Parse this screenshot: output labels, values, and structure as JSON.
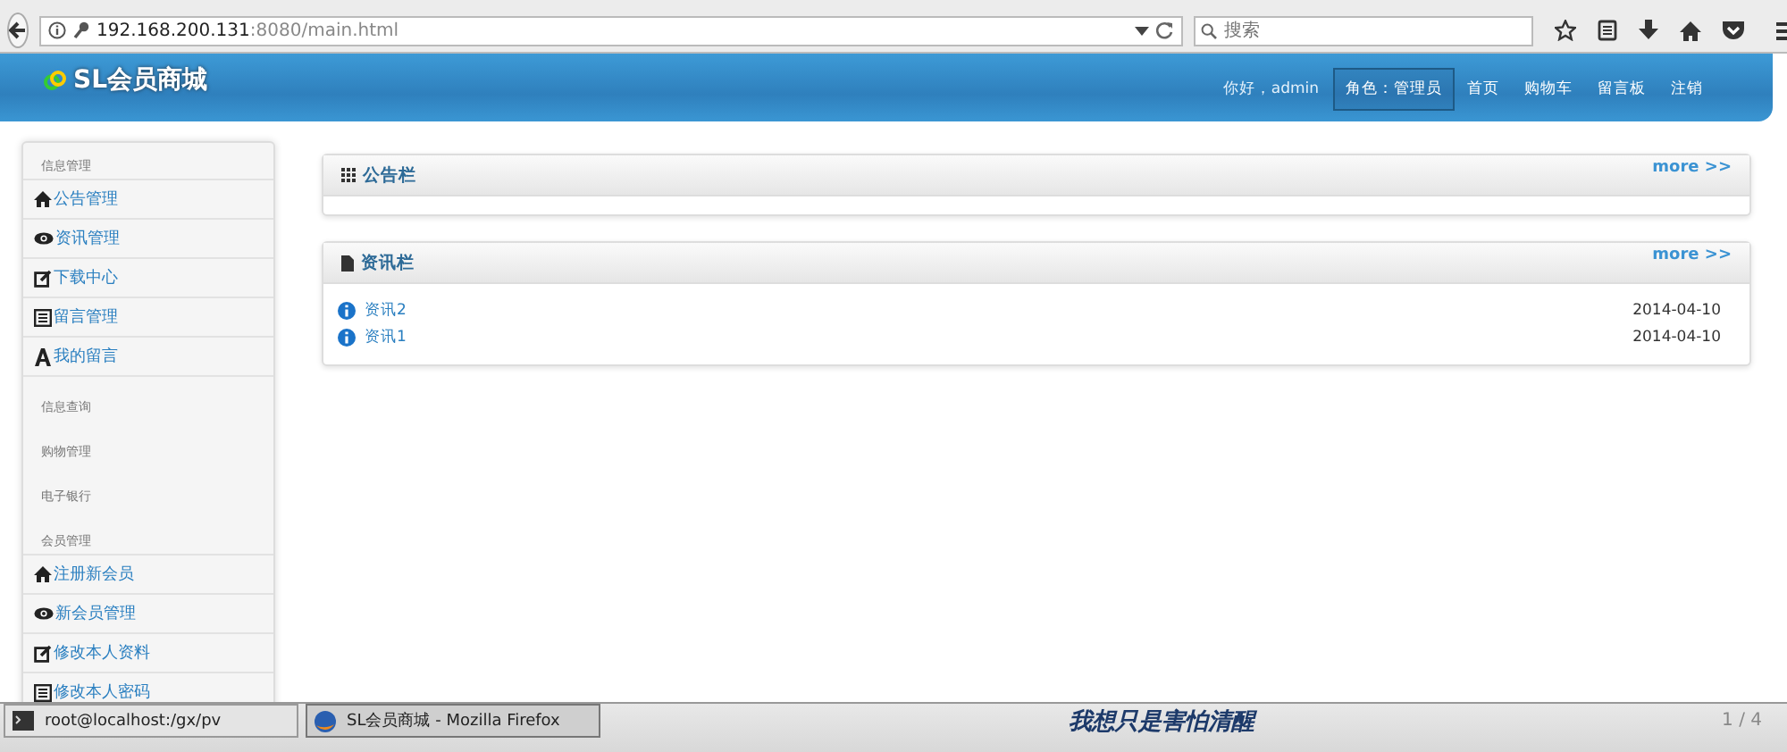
{
  "browser": {
    "url_host": "192.168.200.131",
    "url_rest": ":8080/main.html",
    "search_placeholder": "搜索"
  },
  "header": {
    "logo": "SL会员商城",
    "greeting": "你好，admin",
    "nav": [
      {
        "label": "角色：管理员",
        "selected": true
      },
      {
        "label": "首页",
        "selected": false
      },
      {
        "label": "购物车",
        "selected": false
      },
      {
        "label": "留言板",
        "selected": false
      },
      {
        "label": "注销",
        "selected": false
      }
    ]
  },
  "sidebar": {
    "items": [
      {
        "kind": "heading",
        "label": "信息管理"
      },
      {
        "kind": "link",
        "label": "公告管理"
      },
      {
        "kind": "link",
        "label": "资讯管理"
      },
      {
        "kind": "link",
        "label": "下载中心"
      },
      {
        "kind": "link",
        "label": "留言管理"
      },
      {
        "kind": "link",
        "label": "我的留言"
      },
      {
        "kind": "heading",
        "label": "信息查询"
      },
      {
        "kind": "heading",
        "label": "购物管理"
      },
      {
        "kind": "heading",
        "label": "电子银行"
      },
      {
        "kind": "heading",
        "label": "会员管理"
      },
      {
        "kind": "link",
        "label": "注册新会员"
      },
      {
        "kind": "link",
        "label": "新会员管理"
      },
      {
        "kind": "link",
        "label": "修改本人资料"
      },
      {
        "kind": "link",
        "label": "修改本人密码"
      }
    ]
  },
  "panels": [
    {
      "title": "公告栏",
      "more": "more >>"
    },
    {
      "title": "资讯栏",
      "more": "more >>",
      "items": [
        {
          "title": "资讯2",
          "date": "2014-04-10"
        },
        {
          "title": "资讯1",
          "date": "2014-04-10"
        }
      ]
    }
  ],
  "taskbar": {
    "tasks": [
      {
        "kind": "terminal",
        "label": "root@localhost:/gx/pv",
        "selected": false
      },
      {
        "kind": "browser",
        "label": "SL会员商城 - Mozilla Firefox",
        "selected": true
      }
    ],
    "desktop_text": "我想只是害怕清醒",
    "workspace": "1 / 4"
  }
}
